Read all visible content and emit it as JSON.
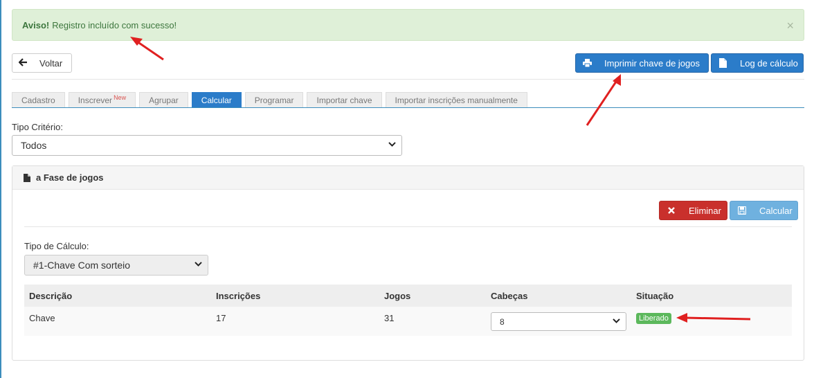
{
  "alert": {
    "title": "Aviso!",
    "message": "Registro incluído com sucesso!",
    "close": "×"
  },
  "toolbar": {
    "back_label": "Voltar",
    "print_label": "Imprimir chave de jogos",
    "log_label": "Log de cálculo"
  },
  "tabs": [
    {
      "label": "Cadastro",
      "badge": ""
    },
    {
      "label": "Inscrever",
      "badge": "New"
    },
    {
      "label": "Agrupar",
      "badge": ""
    },
    {
      "label": "Calcular",
      "badge": "",
      "active": true
    },
    {
      "label": "Programar",
      "badge": ""
    },
    {
      "label": "Importar chave",
      "badge": ""
    },
    {
      "label": "Importar inscrições manualmente",
      "badge": ""
    }
  ],
  "criterio": {
    "label": "Tipo Critério:",
    "value": "Todos"
  },
  "panel": {
    "title": "a Fase de jogos",
    "eliminar_label": "Eliminar",
    "calcular_label": "Calcular",
    "tipo_calculo_label": "Tipo de Cálculo:",
    "tipo_calculo_value": "#1-Chave Com sorteio"
  },
  "table": {
    "headers": [
      "Descrição",
      "Inscrições",
      "Jogos",
      "Cabeças",
      "Situação"
    ],
    "rows": [
      {
        "descricao": "Chave",
        "inscricoes": "17",
        "jogos": "31",
        "cabecas": "8",
        "situacao": "Liberado"
      }
    ]
  },
  "colors": {
    "primary": "#2b7cc9",
    "danger": "#c9302c",
    "success": "#5cb85c",
    "alert_bg": "#dff0d8",
    "annotation_arrow": "#e02020"
  }
}
